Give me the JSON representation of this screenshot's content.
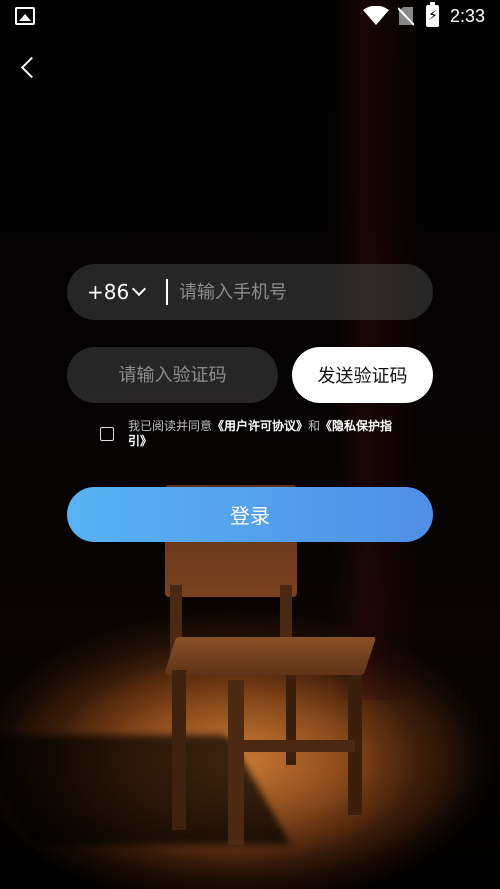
{
  "status_bar": {
    "time": "2:33",
    "icons": [
      "image-icon",
      "wifi-icon",
      "no-sim-icon",
      "battery-charging-icon"
    ],
    "battery_glyph": "⚡"
  },
  "nav": {
    "back_icon": "chevron-left-icon"
  },
  "login": {
    "country_code": "+86",
    "phone_placeholder": "请输入手机号",
    "code_placeholder": "请输入验证码",
    "send_code_label": "发送验证码",
    "agreement_prefix": "我已阅读并同意",
    "user_agreement_link": "《用户许可协议》",
    "agreement_and": "和",
    "privacy_link": "《隐私保护指引》",
    "login_label": "登录"
  },
  "colors": {
    "login_gradient_start": "#59b3f3",
    "login_gradient_end": "#4f8fe6",
    "field_bg": "rgba(70,70,70,0.55)",
    "send_button_bg": "#ffffff"
  }
}
